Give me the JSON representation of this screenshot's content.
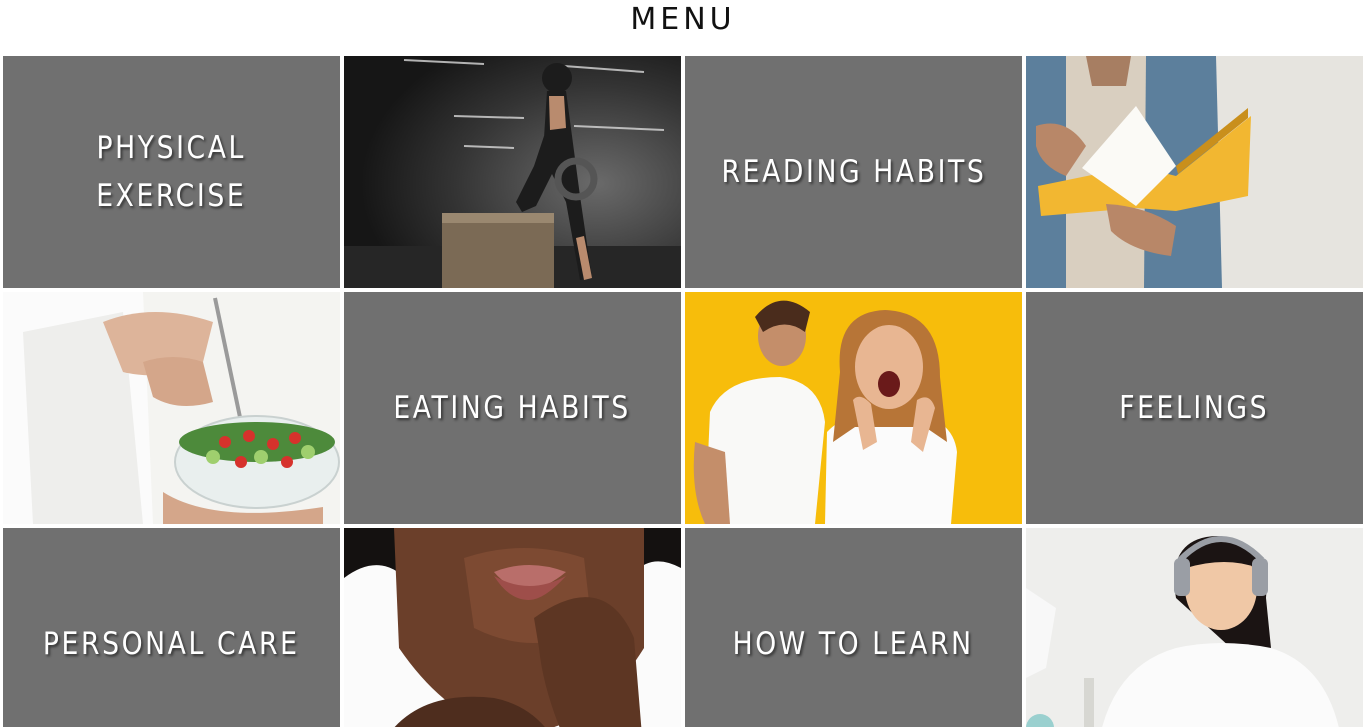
{
  "header": {
    "title": "MENU"
  },
  "menu": {
    "physical_exercise": "PHYSICAL\nEXERCISE",
    "reading_habits": "READING HABITS",
    "eating_habits": "EATING HABITS",
    "feelings": "FEELINGS",
    "personal_care": "PERSONAL CARE",
    "how_to_learn": "HOW TO LEARN"
  },
  "colors": {
    "tile_background": "#707070",
    "tile_text": "#ffffff",
    "yellow_backdrop": "#f7bd0b"
  }
}
